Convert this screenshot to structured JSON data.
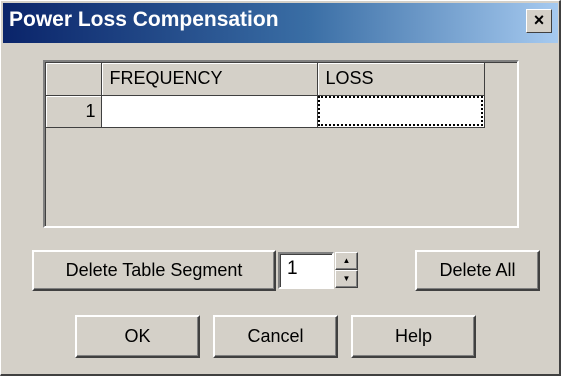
{
  "window": {
    "title": "Power Loss Compensation",
    "close_glyph": "×",
    "titlebar_colors": [
      "#0a246a",
      "#3a6ea5",
      "#a6caf0"
    ]
  },
  "grid": {
    "columns": [
      "FREQUENCY",
      "LOSS"
    ],
    "rows": [
      {
        "row_number": "1",
        "frequency": "",
        "loss": ""
      }
    ],
    "selected_cell": "LOSS"
  },
  "controls": {
    "delete_segment_label": "Delete Table Segment",
    "segment_value": "1",
    "delete_all_label": "Delete All"
  },
  "footer": {
    "ok_label": "OK",
    "cancel_label": "Cancel",
    "help_label": "Help"
  },
  "icons": [
    "close-icon",
    "spin-up-icon",
    "spin-down-icon"
  ]
}
